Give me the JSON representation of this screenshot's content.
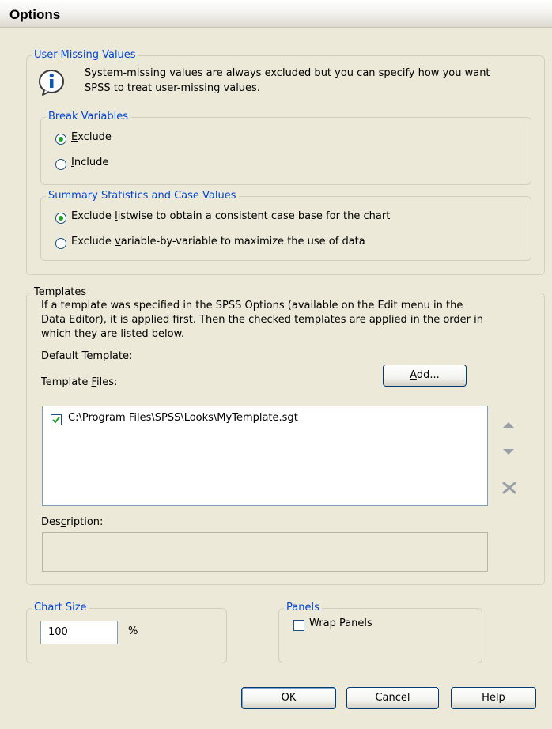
{
  "window": {
    "title": "Options"
  },
  "user_missing": {
    "legend": "User-Missing Values",
    "info_icon": "info-icon",
    "info_text_line1": "System-missing values are always excluded but you can specify how you want",
    "info_text_line2": "SPSS to treat user-missing values.",
    "break_variables": {
      "legend": "Break Variables",
      "options": [
        {
          "label": "Exclude",
          "mnemonic": "E",
          "rest": "xclude",
          "selected": true
        },
        {
          "label": "Include",
          "mnemonic": "I",
          "rest": "nclude",
          "selected": false
        }
      ]
    },
    "summary_statistics": {
      "legend": "Summary Statistics and Case Values",
      "options": [
        {
          "label": "Exclude listwise to obtain a consistent case base for the chart",
          "pre": "Exclude ",
          "mnemonic": "l",
          "rest": "istwise to obtain a consistent case base for the chart",
          "selected": true
        },
        {
          "label": "Exclude variable-by-variable to maximize the use of data",
          "pre": "Exclude ",
          "mnemonic": "v",
          "rest": "ariable-by-variable to maximize the use of data",
          "selected": false
        }
      ]
    }
  },
  "templates": {
    "legend": "Templates",
    "text_line1": "If a template was specified in the SPSS Options (available on the Edit menu in the",
    "text_line2": "Data Editor), it is applied first. Then the checked templates are applied in the order in",
    "text_line3": "which they are listed below.",
    "default_template_label": "Default Template:",
    "template_files_label_pre": "Template ",
    "template_files_mnemonic": "F",
    "template_files_label_rest": "iles:",
    "add_button_mnemonic": "A",
    "add_button_rest": "dd...",
    "files": [
      {
        "path": "C:\\Program Files\\SPSS\\Looks\\MyTemplate.sgt",
        "checked": true
      }
    ],
    "move_up_icon": "arrow-up-icon",
    "move_down_icon": "arrow-down-icon",
    "remove_icon": "remove-x-icon",
    "description_label_pre": "Des",
    "description_mnemonic": "c",
    "description_label_rest": "ription:"
  },
  "chart_size": {
    "legend": "Chart Size",
    "value": "100",
    "unit": "%"
  },
  "panels": {
    "legend": "Panels",
    "wrap_label": "Wrap Panels",
    "wrap_checked": false
  },
  "buttons": {
    "ok": "OK",
    "cancel": "Cancel",
    "help": "Help"
  },
  "colors": {
    "legend_blue": "#0046d5",
    "window_bg": "#ece9d8",
    "radio_dot": "#21a121",
    "check_mark": "#21a121"
  }
}
